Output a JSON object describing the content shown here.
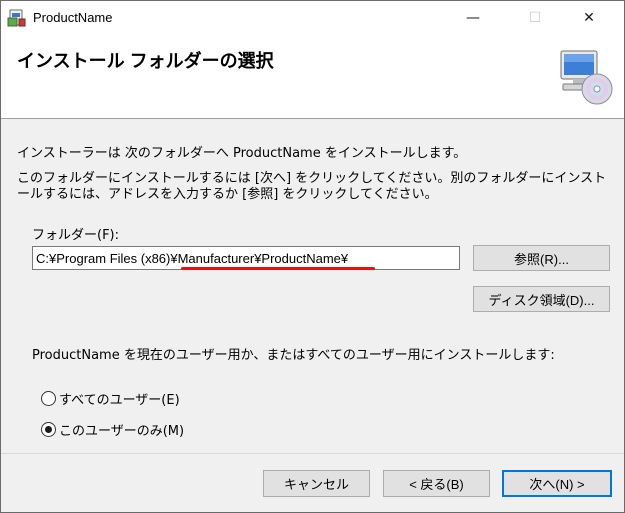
{
  "window": {
    "title": "ProductName",
    "minimize_glyph": "—",
    "maximize_glyph": "☐",
    "close_glyph": "✕"
  },
  "header": {
    "title": "インストール フォルダーの選択",
    "icon": "computer-cd-icon"
  },
  "description": {
    "line1": "インストーラーは 次のフォルダーへ ProductName をインストールします。",
    "line2": "このフォルダーにインストールするには [次へ] をクリックしてください。別のフォルダーにインストールするには、アドレスを入力するか [参照] をクリックしてください。"
  },
  "folder": {
    "label": "フォルダー(F):",
    "path": "C:¥Program Files (x86)¥Manufacturer¥ProductName¥",
    "browse_label": "参照(R)...",
    "disk_label": "ディスク領域(D)..."
  },
  "scope": {
    "question": "ProductName を現在のユーザー用か、またはすべてのユーザー用にインストールします:",
    "options": [
      {
        "label": "すべてのユーザー(E)",
        "selected": false
      },
      {
        "label": "このユーザーのみ(M)",
        "selected": true
      }
    ]
  },
  "footer": {
    "cancel_label": "キャンセル",
    "back_label": "< 戻る(B)",
    "next_label": "次へ(N) >"
  },
  "colors": {
    "accent": "#0078d7",
    "highlight_underline": "#e81010",
    "panel_bg": "#f0f0f0"
  }
}
